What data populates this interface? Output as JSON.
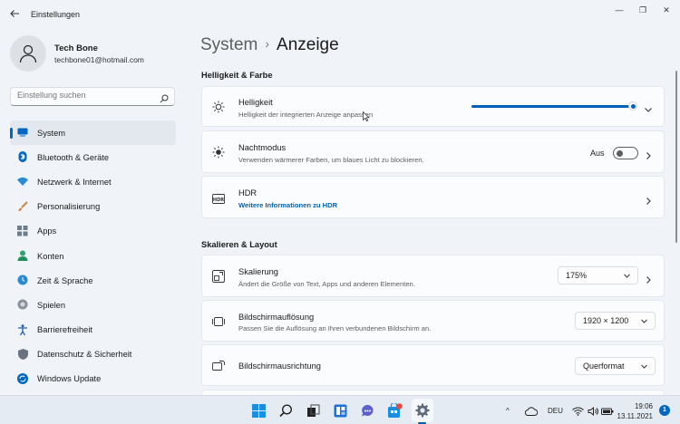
{
  "window": {
    "title": "Einstellungen",
    "minimize": "—",
    "maximize": "❐",
    "close": "✕"
  },
  "user": {
    "name": "Tech Bone",
    "email": "techbone01@hotmail.com"
  },
  "search": {
    "placeholder": "Einstellung suchen",
    "icon": "search-icon"
  },
  "sidebar": {
    "items": [
      {
        "label": "System",
        "icon": "monitor-icon",
        "active": true
      },
      {
        "label": "Bluetooth & Geräte",
        "icon": "bluetooth-icon"
      },
      {
        "label": "Netzwerk & Internet",
        "icon": "wifi-icon"
      },
      {
        "label": "Personalisierung",
        "icon": "brush-icon"
      },
      {
        "label": "Apps",
        "icon": "apps-icon"
      },
      {
        "label": "Konten",
        "icon": "person-icon"
      },
      {
        "label": "Zeit & Sprache",
        "icon": "globe-clock-icon"
      },
      {
        "label": "Spielen",
        "icon": "gamepad-icon"
      },
      {
        "label": "Barrierefreiheit",
        "icon": "accessibility-icon"
      },
      {
        "label": "Datenschutz & Sicherheit",
        "icon": "shield-icon"
      },
      {
        "label": "Windows Update",
        "icon": "update-icon"
      }
    ]
  },
  "breadcrumb": {
    "parent": "System",
    "separator": "›",
    "current": "Anzeige"
  },
  "sections": {
    "brightness_color": "Helligkeit & Farbe",
    "scale_layout": "Skalieren & Layout"
  },
  "cards": {
    "brightness": {
      "title": "Helligkeit",
      "subtitle": "Helligkeit der integrierten Anzeige anpassen",
      "level_percent": 96
    },
    "nightmode": {
      "title": "Nachtmodus",
      "subtitle": "Verwenden wärmerer Farben, um blaues Licht zu blockieren.",
      "toggle_label": "Aus"
    },
    "hdr": {
      "title": "HDR",
      "link": "Weitere Informationen zu HDR"
    },
    "scaling": {
      "title": "Skalierung",
      "subtitle": "Ändert die Größe von Text, Apps und anderen Elementen.",
      "value": "175%"
    },
    "resolution": {
      "title": "Bildschirmauflösung",
      "subtitle": "Passen Sie die Auflösung an Ihren verbundenen Bildschirm an.",
      "value": "1920 × 1200"
    },
    "orientation": {
      "title": "Bildschirmausrichtung",
      "value": "Querformat"
    }
  },
  "taskbar": {
    "icons": [
      "windows-start-icon",
      "search-icon",
      "task-view-icon",
      "widgets-icon",
      "teams-chat-icon",
      "store-icon",
      "settings-icon"
    ],
    "tray": {
      "chevron": "^",
      "language": "DEU"
    },
    "time": "19:06",
    "date": "13.11.2021",
    "notifications": "1"
  },
  "colors": {
    "accent": "#005fb8",
    "background": "#f0f4f9",
    "card": "#fbfcfd"
  }
}
